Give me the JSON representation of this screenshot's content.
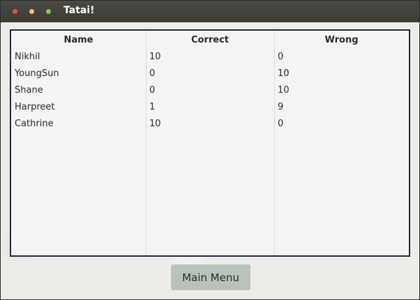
{
  "window": {
    "title": "Tatai!",
    "controls": [
      "close-icon",
      "minimize-icon",
      "maximize-icon"
    ]
  },
  "table": {
    "columns": [
      "Name",
      "Correct",
      "Wrong"
    ],
    "rows": [
      [
        "Nikhil",
        "10",
        "0"
      ],
      [
        "YoungSun",
        "0",
        "10"
      ],
      [
        "Shane",
        "0",
        "10"
      ],
      [
        "Harpreet",
        "1",
        "9"
      ],
      [
        "Cathrine",
        "10",
        "0"
      ]
    ]
  },
  "buttons": {
    "main_menu": "Main Menu"
  },
  "colors": {
    "titlebar": "#3c3b37",
    "close": "#e5523e",
    "minimize": "#f0c56a",
    "maximize": "#8fc34f",
    "table_border": "#1d2a38",
    "button_bg": "#b9c3bc"
  }
}
